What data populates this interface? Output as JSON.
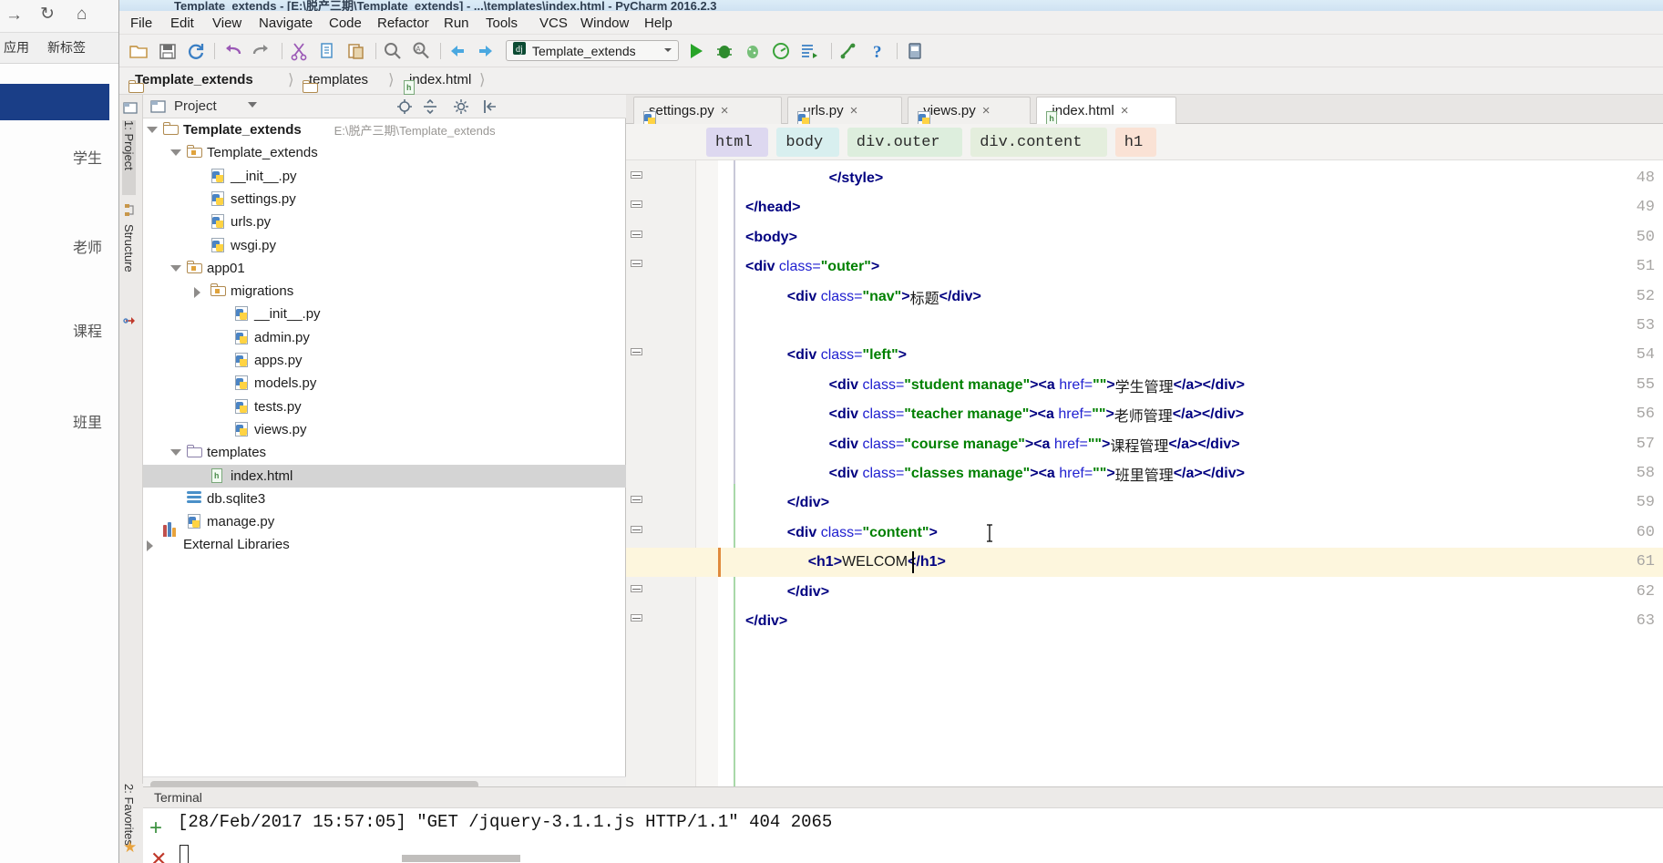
{
  "background_browser": {
    "toolbar_icons": [
      "forward-arrow-icon",
      "reload-icon",
      "home-icon"
    ],
    "tab_label": "新标签",
    "app_label": "应用",
    "sidebar_items": [
      "学生",
      "老师",
      "课程",
      "班里"
    ]
  },
  "window": {
    "title": "Template_extends - [E:\\脱产三期\\Template_extends] - ...\\templates\\index.html - PyCharm 2016.2.3"
  },
  "menu": {
    "items": [
      "File",
      "Edit",
      "View",
      "Navigate",
      "Code",
      "Refactor",
      "Run",
      "Tools",
      "VCS",
      "Window",
      "Help"
    ]
  },
  "toolbar": {
    "icons": [
      "open-folder-icon",
      "save-icon",
      "sync-icon",
      "undo-icon",
      "redo-icon",
      "cut-icon",
      "copy-icon",
      "paste-icon",
      "find-icon",
      "replace-icon",
      "back-icon",
      "forward-icon"
    ],
    "run_config": {
      "icon": "django-icon",
      "label": "Template_extends",
      "dropdown": "chevron-down-icon"
    },
    "run_icons": [
      "run-icon",
      "debug-icon",
      "coverage-icon",
      "profile-icon",
      "run-with-console-icon",
      "attach-icon"
    ],
    "help_icon": "help-icon",
    "settings_icon": "settings-icon"
  },
  "breadcrumb": {
    "items": [
      {
        "label": "Template_extends",
        "icon": "folder-icon",
        "bold": true
      },
      {
        "label": "templates",
        "icon": "folder-icon",
        "bold": false
      },
      {
        "label": "index.html",
        "icon": "html-file-icon",
        "bold": false
      }
    ]
  },
  "left_tool_bars": {
    "top": [
      "1: Project",
      "Structure"
    ],
    "bottom": [
      "2: Favorites"
    ]
  },
  "project_panel": {
    "title": "Project",
    "header_icons": [
      "locate-icon",
      "collapse-all-icon",
      "settings-icon",
      "hide-icon"
    ],
    "tree": [
      {
        "label": "Template_extends",
        "path": "E:\\脱产三期\\Template_extends",
        "icon": "folder-icon",
        "depth": 0,
        "arrow": "open",
        "bold": true
      },
      {
        "label": "Template_extends",
        "path": "",
        "icon": "module-folder-icon",
        "depth": 1,
        "arrow": "open",
        "bold": false
      },
      {
        "label": "__init__.py",
        "path": "",
        "icon": "python-file-icon",
        "depth": 2,
        "arrow": "none",
        "bold": false
      },
      {
        "label": "settings.py",
        "path": "",
        "icon": "python-file-icon",
        "depth": 2,
        "arrow": "none",
        "bold": false
      },
      {
        "label": "urls.py",
        "path": "",
        "icon": "python-file-icon",
        "depth": 2,
        "arrow": "none",
        "bold": false
      },
      {
        "label": "wsgi.py",
        "path": "",
        "icon": "python-file-icon",
        "depth": 2,
        "arrow": "none",
        "bold": false
      },
      {
        "label": "app01",
        "path": "",
        "icon": "module-folder-icon",
        "depth": 1,
        "arrow": "open",
        "bold": false
      },
      {
        "label": "migrations",
        "path": "",
        "icon": "module-folder-icon",
        "depth": 2,
        "arrow": "closed",
        "bold": false
      },
      {
        "label": "__init__.py",
        "path": "",
        "icon": "python-file-icon",
        "depth": 3,
        "arrow": "none",
        "bold": false
      },
      {
        "label": "admin.py",
        "path": "",
        "icon": "python-file-icon",
        "depth": 3,
        "arrow": "none",
        "bold": false
      },
      {
        "label": "apps.py",
        "path": "",
        "icon": "python-file-icon",
        "depth": 3,
        "arrow": "none",
        "bold": false
      },
      {
        "label": "models.py",
        "path": "",
        "icon": "python-file-icon",
        "depth": 3,
        "arrow": "none",
        "bold": false
      },
      {
        "label": "tests.py",
        "path": "",
        "icon": "python-file-icon",
        "depth": 3,
        "arrow": "none",
        "bold": false
      },
      {
        "label": "views.py",
        "path": "",
        "icon": "python-file-icon",
        "depth": 3,
        "arrow": "none",
        "bold": false
      },
      {
        "label": "templates",
        "path": "",
        "icon": "folder-purple-icon",
        "depth": 1,
        "arrow": "open",
        "bold": false
      },
      {
        "label": "index.html",
        "path": "",
        "icon": "html-file-icon",
        "depth": 2,
        "arrow": "none",
        "bold": false,
        "selected": true
      },
      {
        "label": "db.sqlite3",
        "path": "",
        "icon": "database-icon",
        "depth": 1,
        "arrow": "none",
        "bold": false
      },
      {
        "label": "manage.py",
        "path": "",
        "icon": "python-file-icon",
        "depth": 1,
        "arrow": "none",
        "bold": false
      },
      {
        "label": "External Libraries",
        "path": "",
        "icon": "library-icon",
        "depth": 0,
        "arrow": "closed",
        "bold": false
      }
    ]
  },
  "editor": {
    "tabs": [
      {
        "label": "settings.py",
        "icon": "python-file-icon",
        "active": false,
        "close": "×"
      },
      {
        "label": "urls.py",
        "icon": "python-file-icon",
        "active": false,
        "close": "×"
      },
      {
        "label": "views.py",
        "icon": "python-file-icon",
        "active": false,
        "close": "×"
      },
      {
        "label": "index.html",
        "icon": "html-file-icon",
        "active": true,
        "close": "×"
      }
    ],
    "element_path": [
      {
        "label": "html",
        "color": "#ddd8f0"
      },
      {
        "label": "body",
        "color": "#d8efef"
      },
      {
        "label": "div.outer",
        "color": "#ddeedd"
      },
      {
        "label": "div.content",
        "color": "#e4eedd"
      },
      {
        "label": "h1",
        "color": "#fae2d5"
      }
    ],
    "current_line": 61,
    "lines": [
      {
        "num": 48,
        "indent": 4,
        "tokens": [
          {
            "t": "</style>",
            "c": "tag"
          }
        ]
      },
      {
        "num": 49,
        "indent": 0,
        "tokens": [
          {
            "t": "</head>",
            "c": "tag"
          }
        ]
      },
      {
        "num": 50,
        "indent": 0,
        "tokens": [
          {
            "t": "<body>",
            "c": "tag"
          }
        ]
      },
      {
        "num": 51,
        "indent": 0,
        "tokens": [
          {
            "t": "<div ",
            "c": "tag"
          },
          {
            "t": "class=",
            "c": "attr"
          },
          {
            "t": "\"outer\"",
            "c": "val"
          },
          {
            "t": ">",
            "c": "tag"
          }
        ]
      },
      {
        "num": 52,
        "indent": 2,
        "tokens": [
          {
            "t": "<div ",
            "c": "tag"
          },
          {
            "t": "class=",
            "c": "attr"
          },
          {
            "t": "\"nav\"",
            "c": "val"
          },
          {
            "t": ">",
            "c": "tag"
          },
          {
            "t": "标题",
            "c": "txt"
          },
          {
            "t": "</div>",
            "c": "tag"
          }
        ]
      },
      {
        "num": 53,
        "indent": 0,
        "tokens": []
      },
      {
        "num": 54,
        "indent": 2,
        "tokens": [
          {
            "t": "<div ",
            "c": "tag"
          },
          {
            "t": "class=",
            "c": "attr"
          },
          {
            "t": "\"left\"",
            "c": "val"
          },
          {
            "t": ">",
            "c": "tag"
          }
        ]
      },
      {
        "num": 55,
        "indent": 4,
        "tokens": [
          {
            "t": "<div ",
            "c": "tag"
          },
          {
            "t": "class=",
            "c": "attr"
          },
          {
            "t": "\"student manage\"",
            "c": "val"
          },
          {
            "t": ">",
            "c": "tag"
          },
          {
            "t": "<a ",
            "c": "tag"
          },
          {
            "t": "href=",
            "c": "attr"
          },
          {
            "t": "\"\"",
            "c": "val"
          },
          {
            "t": ">",
            "c": "tag"
          },
          {
            "t": "学生管理",
            "c": "txt"
          },
          {
            "t": "</a></div>",
            "c": "tag"
          }
        ]
      },
      {
        "num": 56,
        "indent": 4,
        "tokens": [
          {
            "t": "<div ",
            "c": "tag"
          },
          {
            "t": "class=",
            "c": "attr"
          },
          {
            "t": "\"teacher manage\"",
            "c": "val"
          },
          {
            "t": ">",
            "c": "tag"
          },
          {
            "t": "<a ",
            "c": "tag"
          },
          {
            "t": "href=",
            "c": "attr"
          },
          {
            "t": "\"\"",
            "c": "val"
          },
          {
            "t": ">",
            "c": "tag"
          },
          {
            "t": "老师管理",
            "c": "txt"
          },
          {
            "t": "</a></div>",
            "c": "tag"
          }
        ]
      },
      {
        "num": 57,
        "indent": 4,
        "tokens": [
          {
            "t": "<div ",
            "c": "tag"
          },
          {
            "t": "class=",
            "c": "attr"
          },
          {
            "t": "\"course manage\"",
            "c": "val"
          },
          {
            "t": ">",
            "c": "tag"
          },
          {
            "t": "<a ",
            "c": "tag"
          },
          {
            "t": "href=",
            "c": "attr"
          },
          {
            "t": "\"\"",
            "c": "val"
          },
          {
            "t": ">",
            "c": "tag"
          },
          {
            "t": "课程管理",
            "c": "txt"
          },
          {
            "t": "</a></div>",
            "c": "tag"
          }
        ]
      },
      {
        "num": 58,
        "indent": 4,
        "tokens": [
          {
            "t": "<div ",
            "c": "tag"
          },
          {
            "t": "class=",
            "c": "attr"
          },
          {
            "t": "\"classes manage\"",
            "c": "val"
          },
          {
            "t": ">",
            "c": "tag"
          },
          {
            "t": "<a ",
            "c": "tag"
          },
          {
            "t": "href=",
            "c": "attr"
          },
          {
            "t": "\"\"",
            "c": "val"
          },
          {
            "t": ">",
            "c": "tag"
          },
          {
            "t": "班里管理",
            "c": "txt"
          },
          {
            "t": "</a></div>",
            "c": "tag"
          }
        ]
      },
      {
        "num": 59,
        "indent": 2,
        "tokens": [
          {
            "t": "</div>",
            "c": "tag"
          }
        ]
      },
      {
        "num": 60,
        "indent": 2,
        "tokens": [
          {
            "t": "<div ",
            "c": "tag"
          },
          {
            "t": "class=",
            "c": "attr"
          },
          {
            "t": "\"content\"",
            "c": "val"
          },
          {
            "t": ">",
            "c": "tag"
          }
        ]
      },
      {
        "num": 61,
        "indent": 3,
        "tokens": [
          {
            "t": "<h1>",
            "c": "tag"
          },
          {
            "t": "WELCOM",
            "c": "txt"
          },
          {
            "t": "</h1>",
            "c": "tag"
          }
        ]
      },
      {
        "num": 62,
        "indent": 2,
        "tokens": [
          {
            "t": "</div>",
            "c": "tag"
          }
        ]
      },
      {
        "num": 63,
        "indent": 0,
        "tokens": [
          {
            "t": "</div>",
            "c": "tag"
          }
        ]
      }
    ]
  },
  "terminal": {
    "title": "Terminal",
    "new_session_icon": "plus-icon",
    "close_session_icon": "close-icon",
    "log": "[28/Feb/2017 15:57:05] \"GET /jquery-3.1.1.js HTTP/1.1\" 404 2065"
  },
  "colors": {
    "accent_blue": "#1a3e87",
    "tag_navy": "#000080",
    "attr_blue": "#2020d0",
    "value_green": "#008000",
    "current_line": "#fdf6dd",
    "selection_gray": "#d4d4d4"
  }
}
